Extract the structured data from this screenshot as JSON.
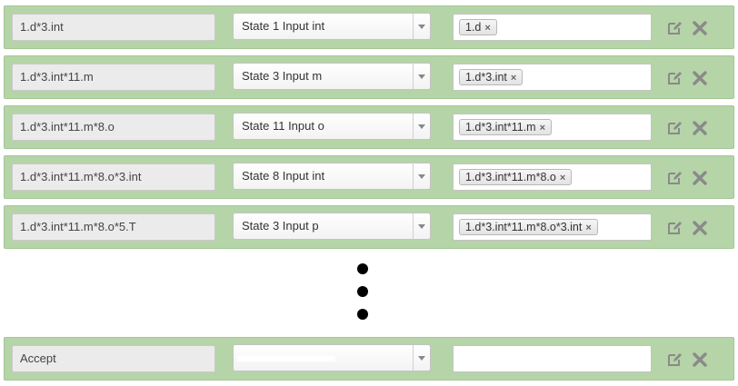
{
  "rows": [
    {
      "name": "1.d*3.int",
      "state_select": "State 1 Input int",
      "tag": "1.d"
    },
    {
      "name": "1.d*3.int*11.m",
      "state_select": "State 3 Input m",
      "tag": "1.d*3.int"
    },
    {
      "name": "1.d*3.int*11.m*8.o",
      "state_select": "State 11 Input o",
      "tag": "1.d*3.int*11.m"
    },
    {
      "name": "1.d*3.int*11.m*8.o*3.int",
      "state_select": "State 8 Input int",
      "tag": "1.d*3.int*11.m*8.o"
    },
    {
      "name": "1.d*3.int*11.m*8.o*5.T",
      "state_select": "State 3 Input p",
      "tag": "1.d*3.int*11.m*8.o*3.int"
    }
  ],
  "final_row": {
    "name": "Accept",
    "state_select": "",
    "tag_value": ""
  },
  "tag_remove_glyph": "×",
  "icons": {
    "edit": "edit-icon",
    "delete": "close-icon",
    "color": "#8a8a8a",
    "continuation": "vertical-ellipsis"
  },
  "colors": {
    "row_background": "#b5d4a7",
    "field_background": "#ebebeb"
  }
}
